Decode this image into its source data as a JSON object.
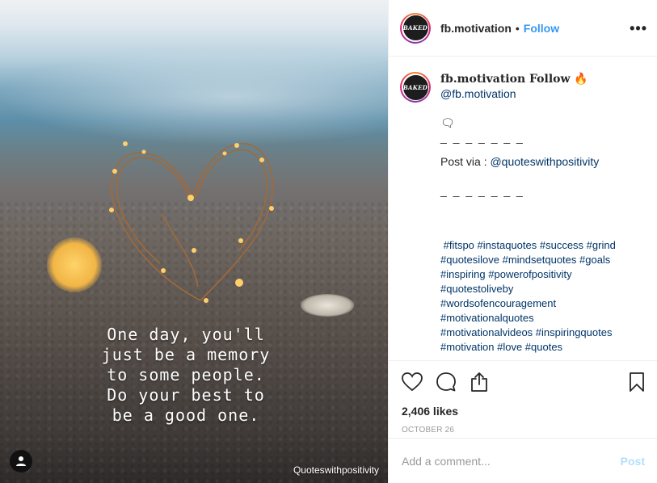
{
  "post": {
    "quote_lines": [
      "One day, you'll",
      "just be a memory",
      "to some people.",
      "Do your best to",
      "be a good one."
    ],
    "image_credit": "Quoteswithpositivity"
  },
  "header": {
    "avatar_text": "BAKED",
    "username": "fb.motivation",
    "separator": "•",
    "follow_label": "Follow",
    "more_label": "•••"
  },
  "caption": {
    "avatar_text": "BAKED",
    "title": "fb.motivation Follow 🔥",
    "handle": "@fb.motivation",
    "speech_icon": "🗨",
    "separator": "_ _ _ _ _ _ _",
    "post_via_prefix": "Post via : ",
    "post_via_handle": "@quoteswithpositivity",
    "separator2": "_ _ _ _ _ _ _",
    "hashtag_lines": [
      " #fitspo #instaquotes #success #grind",
      "#quotesilove #mindsetquotes #goals",
      "#inspiring #powerofpositivity",
      "#quotestoliveby",
      "#wordsofencouragement",
      "#motivationalquotes",
      "#motivationalvideos #inspiringquotes",
      "#motivation #love #quotes"
    ]
  },
  "actions": {
    "icons": [
      "heart-icon",
      "comment-icon",
      "share-icon",
      "bookmark-icon"
    ],
    "likes": "2,406 likes",
    "date": "OCTOBER 26"
  },
  "comment_box": {
    "placeholder": "Add a comment...",
    "post_label": "Post"
  },
  "colors": {
    "link": "#3897f0",
    "hashtag": "#003569",
    "post_disabled": "#b2dffc",
    "divider": "#efefef"
  }
}
